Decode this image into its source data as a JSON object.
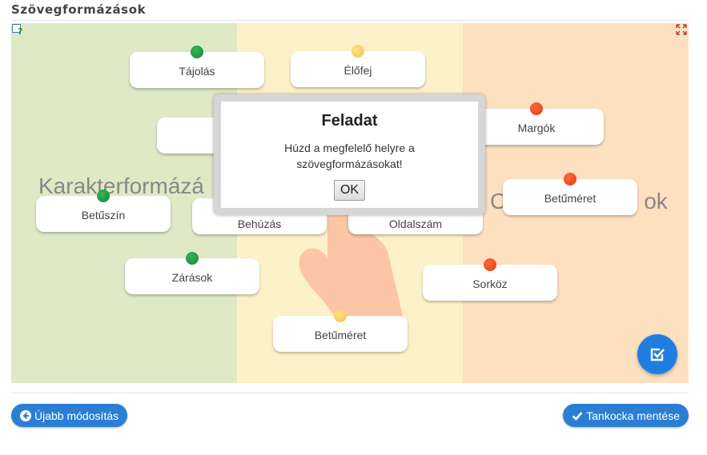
{
  "page": {
    "title": "Szövegformázások"
  },
  "zones": [
    {
      "label": "Karakterformázá",
      "color": "#dfe9c5"
    },
    {
      "label": "",
      "color": "#fdf1c9"
    },
    {
      "label": "C",
      "label_tail": "ok",
      "color": "#fde0c0"
    }
  ],
  "cards": {
    "tajolas": "Tájolás",
    "elofej": "Élőfej",
    "margok": "Margók",
    "betumeret_red": "Betűméret",
    "betuszin": "Betűszín",
    "behuzas": "Behúzás",
    "oldalszam": "Oldalszám",
    "zarasok": "Zárások",
    "sorkoz": "Sorköz",
    "betumeret_yellow": "Betűméret"
  },
  "modal": {
    "title": "Feladat",
    "message": "Húzd a megfelelő helyre a szövegformázásokat!",
    "ok_label": "OK"
  },
  "buttons": {
    "back_label": "Újabb módosítás",
    "save_label": "Tankocka mentése"
  },
  "colors": {
    "accent": "#2a7fd4",
    "dot_green": "#159a3c",
    "dot_yellow": "#f8c653",
    "dot_red": "#ee4216"
  },
  "icons": [
    "help-icon",
    "fullscreen-icon",
    "check-icon",
    "arrow-left-icon",
    "checkmark-icon"
  ]
}
